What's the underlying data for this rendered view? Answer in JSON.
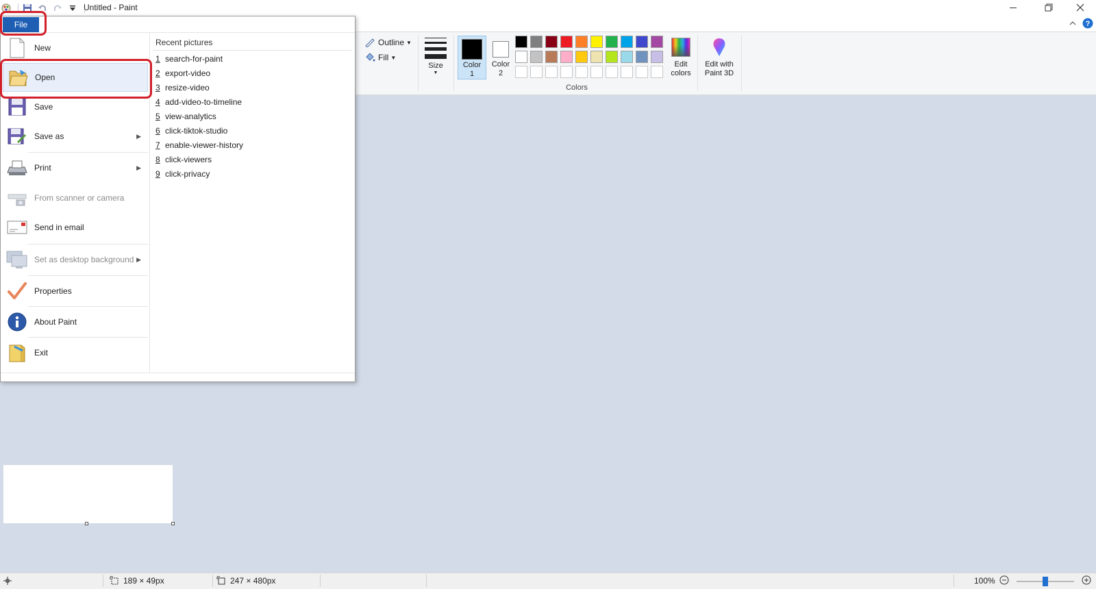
{
  "window": {
    "title": "Untitled - Paint"
  },
  "file_menu": {
    "file_button": "File",
    "left_items": [
      {
        "label": "New",
        "icon": "new-page-icon",
        "disabled": false,
        "submenu": false
      },
      {
        "label": "Open",
        "icon": "folder-open-icon",
        "disabled": false,
        "submenu": false
      },
      {
        "label": "Save",
        "icon": "floppy-disk-icon",
        "disabled": false,
        "submenu": false
      },
      {
        "label": "Save as",
        "icon": "save-as-icon",
        "disabled": false,
        "submenu": true
      },
      {
        "label": "Print",
        "icon": "printer-icon",
        "disabled": false,
        "submenu": true
      },
      {
        "label": "From scanner or camera",
        "icon": "scanner-icon",
        "disabled": true,
        "submenu": false
      },
      {
        "label": "Send in email",
        "icon": "email-icon",
        "disabled": false,
        "submenu": false
      },
      {
        "label": "Set as desktop background",
        "icon": "desktop-icon",
        "disabled": true,
        "submenu": true
      },
      {
        "label": "Properties",
        "icon": "checkmark-icon",
        "disabled": false,
        "submenu": false
      },
      {
        "label": "About Paint",
        "icon": "info-icon",
        "disabled": false,
        "submenu": false
      },
      {
        "label": "Exit",
        "icon": "exit-folder-icon",
        "disabled": false,
        "submenu": false
      }
    ],
    "recent_title": "Recent pictures",
    "recent_items": [
      {
        "num": "1",
        "label": "search-for-paint"
      },
      {
        "num": "2",
        "label": "export-video"
      },
      {
        "num": "3",
        "label": "resize-video"
      },
      {
        "num": "4",
        "label": "add-video-to-timeline"
      },
      {
        "num": "5",
        "label": "view-analytics"
      },
      {
        "num": "6",
        "label": "click-tiktok-studio"
      },
      {
        "num": "7",
        "label": "enable-viewer-history"
      },
      {
        "num": "8",
        "label": "click-viewers"
      },
      {
        "num": "9",
        "label": "click-privacy"
      }
    ]
  },
  "ribbon": {
    "outline_label": "Outline",
    "fill_label": "Fill",
    "size_label": "Size",
    "color1_label_a": "Color",
    "color1_label_b": "1",
    "color2_label_a": "Color",
    "color2_label_b": "2",
    "colors_group_label": "Colors",
    "edit_colors_a": "Edit",
    "edit_colors_b": "colors",
    "paint3d_a": "Edit with",
    "paint3d_b": "Paint 3D",
    "palette_row1": [
      "#000000",
      "#7f7f7f",
      "#880015",
      "#ed1c24",
      "#ff7f27",
      "#fff200",
      "#22b14c",
      "#00a2e8",
      "#3f48cc",
      "#a349a4"
    ],
    "palette_row2": [
      "#ffffff",
      "#c3c3c3",
      "#b97a57",
      "#ffaec9",
      "#ffc90e",
      "#efe4b0",
      "#b5e61d",
      "#99d9ea",
      "#7092be",
      "#c8bfe7"
    ],
    "color1": "#000000",
    "color2": "#ffffff"
  },
  "status": {
    "selection_size": "189 × 49px",
    "canvas_size": "247 × 480px",
    "zoom": "100%",
    "zoom_level_fraction": 0.5
  },
  "annotations": {
    "highlight_color": "#d21f2a"
  }
}
